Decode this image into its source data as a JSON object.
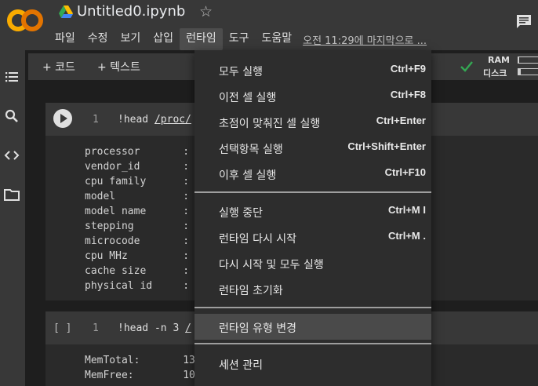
{
  "header": {
    "logo_text": "CO",
    "title": "Untitled0.ipynb",
    "star_glyph": "☆",
    "menu": [
      "파일",
      "수정",
      "보기",
      "삽입",
      "런타임",
      "도구",
      "도움말"
    ],
    "active_menu": "런타임",
    "last_saved": "오전 11:29에 마지막으로 ..."
  },
  "toolbar": {
    "add_code": "+ 코드",
    "add_text": "+ 텍스트",
    "ram_label": "RAM",
    "disk_label": "디스크",
    "ram_usage": 0.05,
    "disk_usage": 0.12,
    "status_color": "#34a853"
  },
  "cells": [
    {
      "line_number": "1",
      "code_prefix": "!head ",
      "code_path": "/proc/",
      "output": [
        "processor       :",
        "vendor_id       :",
        "cpu family      :",
        "model           :",
        "model name      :",
        "stepping        :",
        "microcode       :",
        "cpu MHz         :",
        "cache size      :",
        "physical id     :"
      ]
    },
    {
      "exec_count": "[ ]",
      "line_number": "1",
      "code_prefix": "!head -n 3 ",
      "code_path": "/",
      "output": [
        "MemTotal:       13",
        "MemFree:        10"
      ]
    }
  ],
  "runtime_menu": {
    "groups": [
      [
        {
          "label": "모두 실행",
          "shortcut": "Ctrl+F9"
        },
        {
          "label": "이전 셀 실행",
          "shortcut": "Ctrl+F8"
        },
        {
          "label": "초점이 맞춰진 셀 실행",
          "shortcut": "Ctrl+Enter"
        },
        {
          "label": "선택항목 실행",
          "shortcut": "Ctrl+Shift+Enter"
        },
        {
          "label": "이후 셀 실행",
          "shortcut": "Ctrl+F10"
        }
      ],
      [
        {
          "label": "실행 중단",
          "shortcut": "Ctrl+M I"
        },
        {
          "label": "런타임 다시 시작",
          "shortcut": "Ctrl+M ."
        },
        {
          "label": "다시 시작 및 모두 실행",
          "shortcut": ""
        },
        {
          "label": "런타임 초기화",
          "shortcut": ""
        }
      ],
      [
        {
          "label": "런타임 유형 변경",
          "shortcut": ""
        }
      ],
      [
        {
          "label": "세션 관리",
          "shortcut": ""
        }
      ]
    ],
    "highlighted": "런타임 유형 변경"
  },
  "colors": {
    "logo_orange": "#f9ab00",
    "logo_dark": "#e37400",
    "background": "#1e1e1e",
    "header": "#383838",
    "menu_bg": "#2d2d2d"
  }
}
